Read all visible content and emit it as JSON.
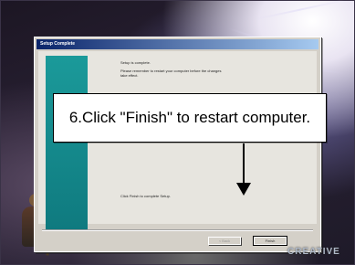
{
  "dialog": {
    "title": "Setup Complete",
    "message_title": "Setup is complete.",
    "message_line_1": "Please remember to restart your computer before the changes",
    "message_line_2": "take effect.",
    "lower_message": "Click Finish to complete Setup.",
    "back_label": "< Back",
    "finish_label": "Finish"
  },
  "callout": {
    "text": "6.Click \"Finish\" to restart computer."
  },
  "branding": {
    "logo_text": "CREATIVE"
  },
  "colors": {
    "titlebar_start": "#0a246a",
    "titlebar_end": "#a6caf0",
    "side_panel": "#1b9a9a"
  }
}
